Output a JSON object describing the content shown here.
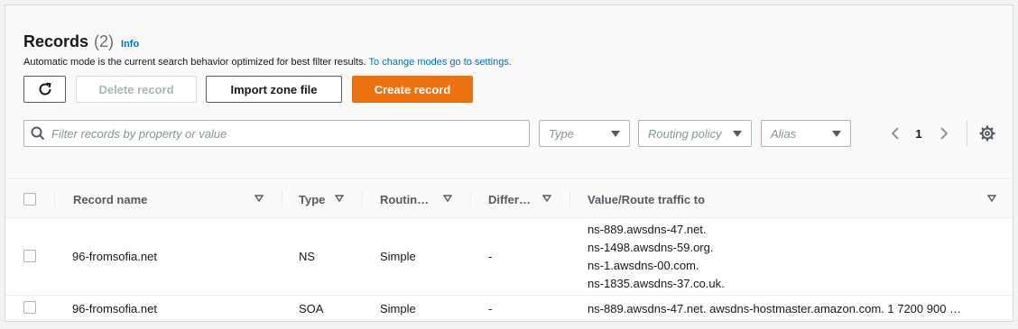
{
  "header": {
    "title": "Records",
    "count": "(2)",
    "info": "Info",
    "description": "Automatic mode is the current search behavior optimized for best filter results.",
    "description_link": "To change modes go to settings."
  },
  "toolbar": {
    "refresh_icon": "refresh-icon",
    "delete_label": "Delete record",
    "import_label": "Import zone file",
    "create_label": "Create record"
  },
  "filters": {
    "search_placeholder": "Filter records by property or value",
    "type_placeholder": "Type",
    "routing_placeholder": "Routing policy",
    "alias_placeholder": "Alias"
  },
  "pagination": {
    "page": "1"
  },
  "table": {
    "columns": [
      "Record name",
      "Type",
      "Routin…",
      "Differ…",
      "Value/Route traffic to"
    ],
    "rows": [
      {
        "name": "96-fromsofia.net",
        "type": "NS",
        "routing": "Simple",
        "differ": "-",
        "values": [
          "ns-889.awsdns-47.net.",
          "ns-1498.awsdns-59.org.",
          "ns-1.awsdns-00.com.",
          "ns-1835.awsdns-37.co.uk."
        ]
      },
      {
        "name": "96-fromsofia.net",
        "type": "SOA",
        "routing": "Simple",
        "differ": "-",
        "values": [
          "ns-889.awsdns-47.net. awsdns-hostmaster.amazon.com. 1 7200 900 …"
        ]
      }
    ]
  },
  "colors": {
    "accent": "#ec7211",
    "link": "#0073bb"
  }
}
